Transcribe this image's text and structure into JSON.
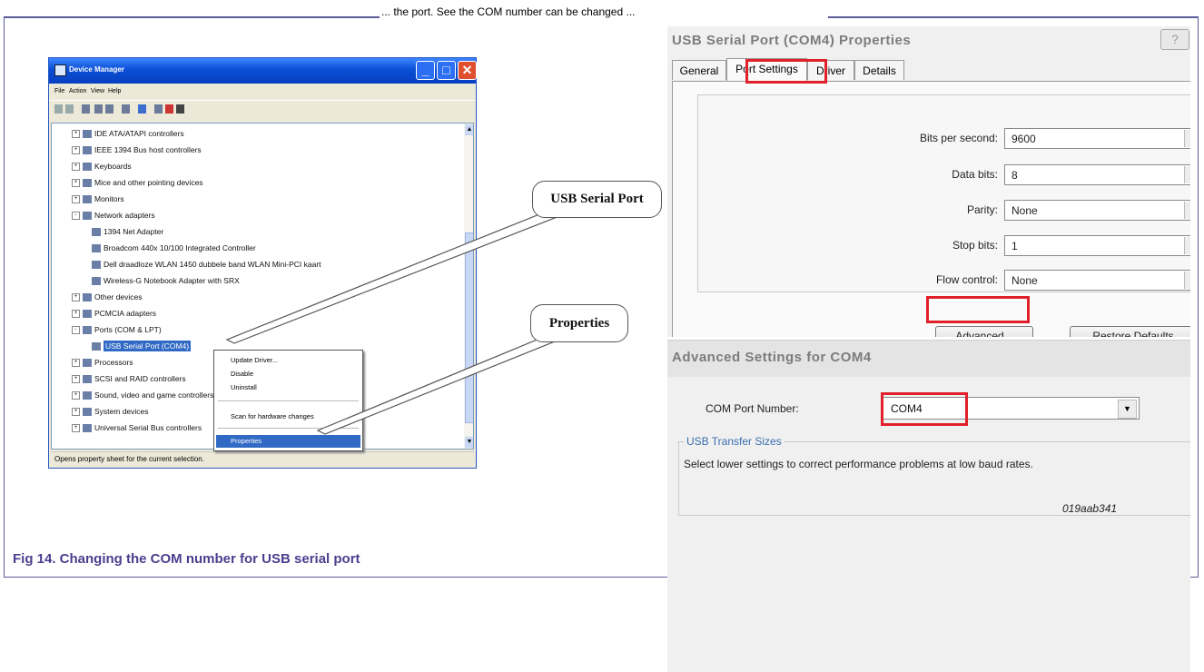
{
  "header_cut_text": "... the port. See the COM number can be changed ...",
  "device_manager": {
    "title": "Device Manager",
    "menu": [
      "File",
      "Action",
      "View",
      "Help"
    ],
    "tree": [
      {
        "label": "IDE ATA/ATAPI controllers",
        "level": 0,
        "exp": "+"
      },
      {
        "label": "IEEE 1394 Bus host controllers",
        "level": 0,
        "exp": "+"
      },
      {
        "label": "Keyboards",
        "level": 0,
        "exp": "+"
      },
      {
        "label": "Mice and other pointing devices",
        "level": 0,
        "exp": "+"
      },
      {
        "label": "Monitors",
        "level": 0,
        "exp": "+"
      },
      {
        "label": "Network adapters",
        "level": 0,
        "exp": "-"
      },
      {
        "label": "1394 Net Adapter",
        "level": 1,
        "exp": ""
      },
      {
        "label": "Broadcom 440x 10/100 Integrated Controller",
        "level": 1,
        "exp": ""
      },
      {
        "label": "Dell draadloze WLAN 1450 dubbele band WLAN Mini-PCI kaart",
        "level": 1,
        "exp": ""
      },
      {
        "label": "Wireless-G Notebook Adapter with SRX",
        "level": 1,
        "exp": ""
      },
      {
        "label": "Other devices",
        "level": 0,
        "exp": "+"
      },
      {
        "label": "PCMCIA adapters",
        "level": 0,
        "exp": "+"
      },
      {
        "label": "Ports (COM & LPT)",
        "level": 0,
        "exp": "-"
      },
      {
        "label": "USB Serial Port (COM4)",
        "level": 1,
        "exp": "",
        "selected": true
      },
      {
        "label": "Processors",
        "level": 0,
        "exp": "+"
      },
      {
        "label": "SCSI and RAID controllers",
        "level": 0,
        "exp": "+"
      },
      {
        "label": "Sound, video and game controllers",
        "level": 0,
        "exp": "+"
      },
      {
        "label": "System devices",
        "level": 0,
        "exp": "+"
      },
      {
        "label": "Universal Serial Bus controllers",
        "level": 0,
        "exp": "+"
      }
    ],
    "context_menu": [
      "Update Driver...",
      "Disable",
      "Uninstall",
      "Scan for hardware changes",
      "Properties"
    ],
    "context_highlight": "Properties",
    "status": "Opens property sheet for the current selection."
  },
  "callouts": {
    "usb_serial_port": "USB Serial Port",
    "properties": "Properties"
  },
  "properties_dialog": {
    "title": "USB Serial Port (COM4) Properties",
    "help": "?",
    "tabs": [
      "General",
      "Port Settings",
      "Driver",
      "Details"
    ],
    "active_tab": "Port Settings",
    "fields": [
      {
        "label": "Bits per second:",
        "value": "9600"
      },
      {
        "label": "Data bits:",
        "value": "8"
      },
      {
        "label": "Parity:",
        "value": "None"
      },
      {
        "label": "Stop bits:",
        "value": "1"
      },
      {
        "label": "Flow control:",
        "value": "None"
      }
    ],
    "advanced_button": "Advanced...",
    "restore_button": "Restore Defaults"
  },
  "advanced_dialog": {
    "title": "Advanced Settings for COM4",
    "com_port_label": "COM Port Number:",
    "com_port_value": "COM4",
    "transfer_legend": "USB Transfer Sizes",
    "transfer_text": "Select lower settings to correct performance problems at low baud rates."
  },
  "figure_id": "019aab341",
  "caption": "Fig 14.  Changing the COM number for USB serial port",
  "colors": {
    "highlight_red": "#e0202a",
    "caption": "#4a3f8f",
    "xp_title": "#0a4fd6"
  }
}
